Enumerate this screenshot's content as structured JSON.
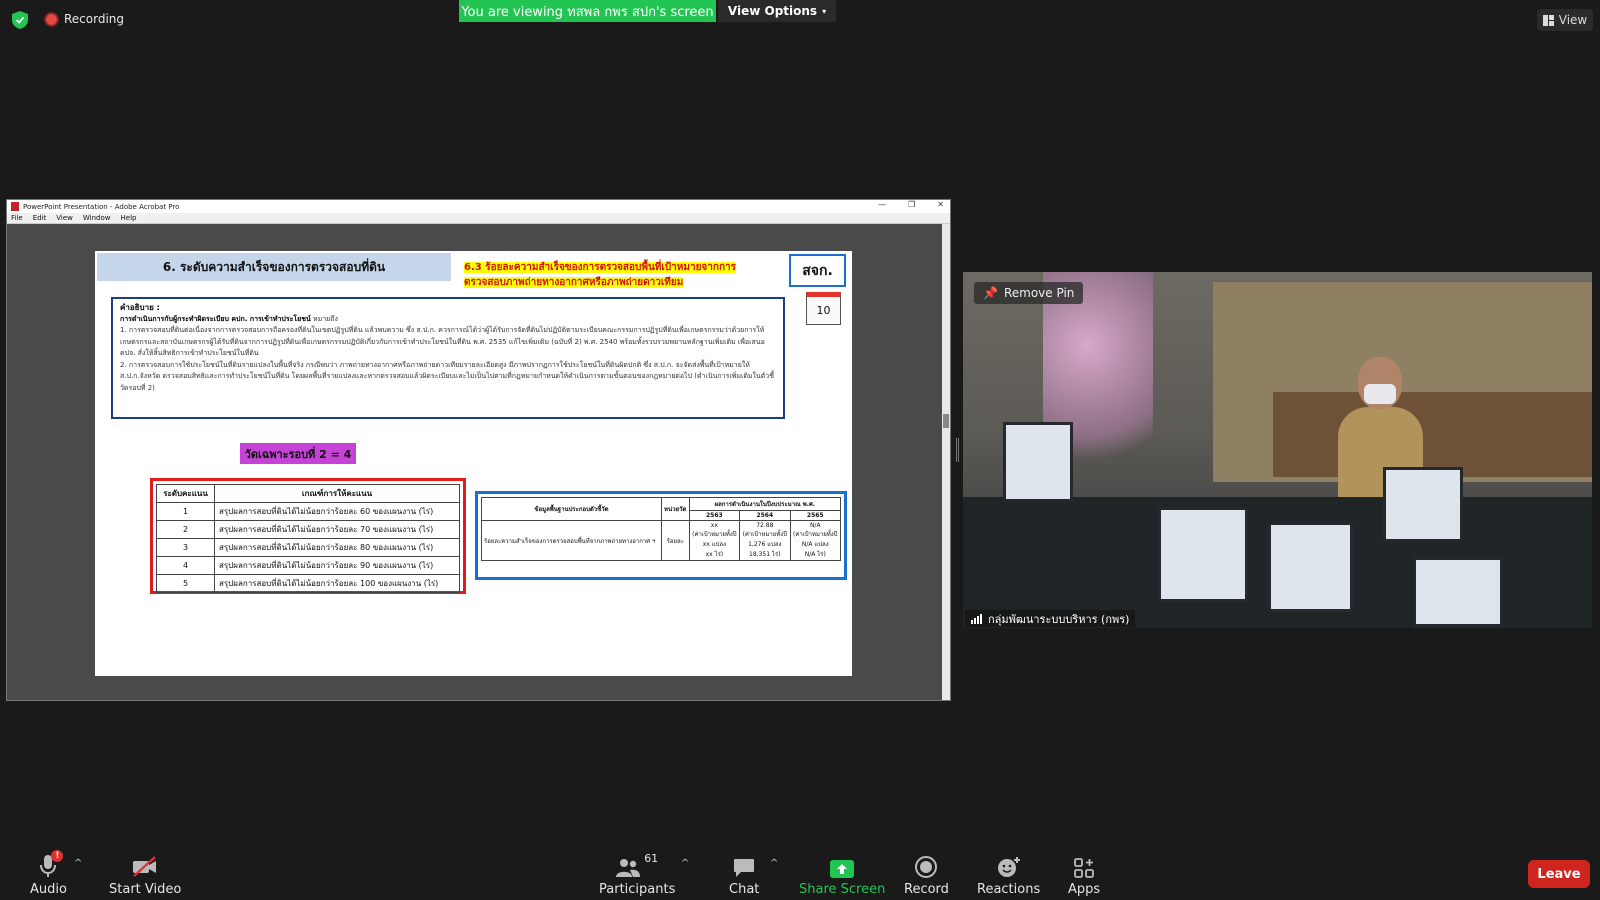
{
  "topbar": {
    "recording_label": "Recording",
    "viewing_banner": "You are viewing ทสพล กพร สปก's screen",
    "view_options_label": "View Options",
    "view_label": "View"
  },
  "acrobat": {
    "title": "PowerPoint Presentation - Adobe Acrobat Pro",
    "menu": [
      "File",
      "Edit",
      "View",
      "Window",
      "Help"
    ]
  },
  "slide": {
    "title": "6. ระดับความสำเร็จของการตรวจสอบที่ดิน",
    "header_line1": "6.3 ร้อยละความสำเร็จของการตรวจสอบพื้นที่เป้าหมายจากการ",
    "header_line2": "ตรวจสอบภาพถ่ายทางอากาศหรือภาพถ่ายดาวเทียม",
    "org_badge": "สจก.",
    "calendar_number": "10",
    "desc_heading": "คำอธิบาย :",
    "desc_subheading": "การดำเนินการกับผู้กระทำผิดระเบียบ คปก. การเข้าทำประโยชน์",
    "desc_subheading_tail": "หมายถึง",
    "desc_p1": "1. การตรวจสอบที่ดินต่อเนื่องจากการตรวจสอบการถือครองที่ดินในเขตปฏิรูปที่ดิน แล้วพบความ ซึ่ง ส.ป.ก. ควรการณ์ได้ว่าผู้ได้รับการจัดที่ดินไม่ปฏิบัติตามระเบียบคณะกรรมการปฏิรูปที่ดินเพื่อเกษตรกรรมว่าด้วยการให้เกษตรกรและสถาบันเกษตรกรผู้ได้รับที่ดินจากการปฏิรูปที่ดินเพื่อเกษตรกรรมปฏิบัติเกี่ยวกับการเข้าทำประโยชน์ในที่ดิน พ.ศ. 2535 แก้ไขเพิ่มเติม (ฉบับที่ 2) พ.ศ. 2540 พร้อมทั้งรวบรวมพยานหลักฐานเพิ่มเติม เพื่อเสนอ คปจ. สั่งให้สิ้นสิทธิการเข้าทำประโยชน์ในที่ดิน",
    "desc_p2": "2. การตรวจสอบการใช้ประโยชน์ในที่ดินรายแปลงในพื้นที่จริง กรณีพบว่า ภาพถ่ายทางอากาศหรือภาพถ่ายดาวเทียมรายละเอียดสูง มีภาพปรากฏการใช้ประโยชน์ในที่ดินผิดปกติ ซึ่ง ส.ป.ก. จะจัดส่งพื้นที่เป้าหมายให้ ส.ป.ก.จังหวัด ตรวจสอบสิทธิและการทำประโยชน์ในที่ดิน โดยผลพื้นที่รายแปลงและหากตรวจสอบแล้วผิดระเบียบและไม่เป็นไปตามที่กฎหมายกำหนดให้ดำเนินการตามขั้นตอนของกฎหมายต่อไป (ดำเนินการเพิ่มเติมในตัวชี้วัดรอบที่ 2)",
    "round_label": "วัดเฉพาะรอบที่ 2 = 4",
    "score_table": {
      "headers": [
        "ระดับคะแนน",
        "เกณฑ์การให้คะแนน"
      ],
      "rows": [
        [
          "1",
          "สรุปผลการสอบที่ดินได้ไม่น้อยกว่าร้อยละ 60 ของแผนงาน (ไร่)"
        ],
        [
          "2",
          "สรุปผลการสอบที่ดินได้ไม่น้อยกว่าร้อยละ 70 ของแผนงาน (ไร่)"
        ],
        [
          "3",
          "สรุปผลการสอบที่ดินได้ไม่น้อยกว่าร้อยละ 80 ของแผนงาน (ไร่)"
        ],
        [
          "4",
          "สรุปผลการสอบที่ดินได้ไม่น้อยกว่าร้อยละ 90 ของแผนงาน (ไร่)"
        ],
        [
          "5",
          "สรุปผลการสอบที่ดินได้ไม่น้อยกว่าร้อยละ 100 ของแผนงาน (ไร่)"
        ]
      ]
    },
    "result_table": {
      "col_indicator": "ข้อมูลพื้นฐานประกอบตัวชี้วัด",
      "col_unit": "หน่วยวัด",
      "col_results": "ผลการดำเนินงานในปีงบประมาณ พ.ศ.",
      "years": [
        "2563",
        "2564",
        "2565"
      ],
      "row_indicator": "ร้อยละความสำเร็จของการตรวจสอบพื้นที่จากภาพถ่ายทางอากาศ ฯ",
      "row_unit": "ร้อยละ",
      "row_values": [
        [
          "xx",
          "(ค่าเป้าหมายทั้งปี",
          "xx แปลง",
          "xx ไร่)"
        ],
        [
          "72.88",
          "(ค่าเป้าหมายทั้งปี",
          "1,276 แปลง",
          "18,351 ไร่)"
        ],
        [
          "N/A",
          "(ค่าเป้าหมายทั้งปี",
          "N/A แปลง",
          "N/A ไร่)"
        ]
      ]
    }
  },
  "video": {
    "remove_pin_label": "Remove Pin",
    "participant_name": "กลุ่มพัฒนาระบบบริหาร (กพร)"
  },
  "toolbar": {
    "audio": "Audio",
    "audio_badge": "!",
    "start_video": "Start Video",
    "participants": "Participants",
    "participants_count": "61",
    "chat": "Chat",
    "share_screen": "Share Screen",
    "record": "Record",
    "reactions": "Reactions",
    "apps": "Apps",
    "leave": "Leave"
  },
  "colors": {
    "share_green": "#23c552",
    "leave_red": "#d0251f",
    "background": "#1a1a1a"
  }
}
